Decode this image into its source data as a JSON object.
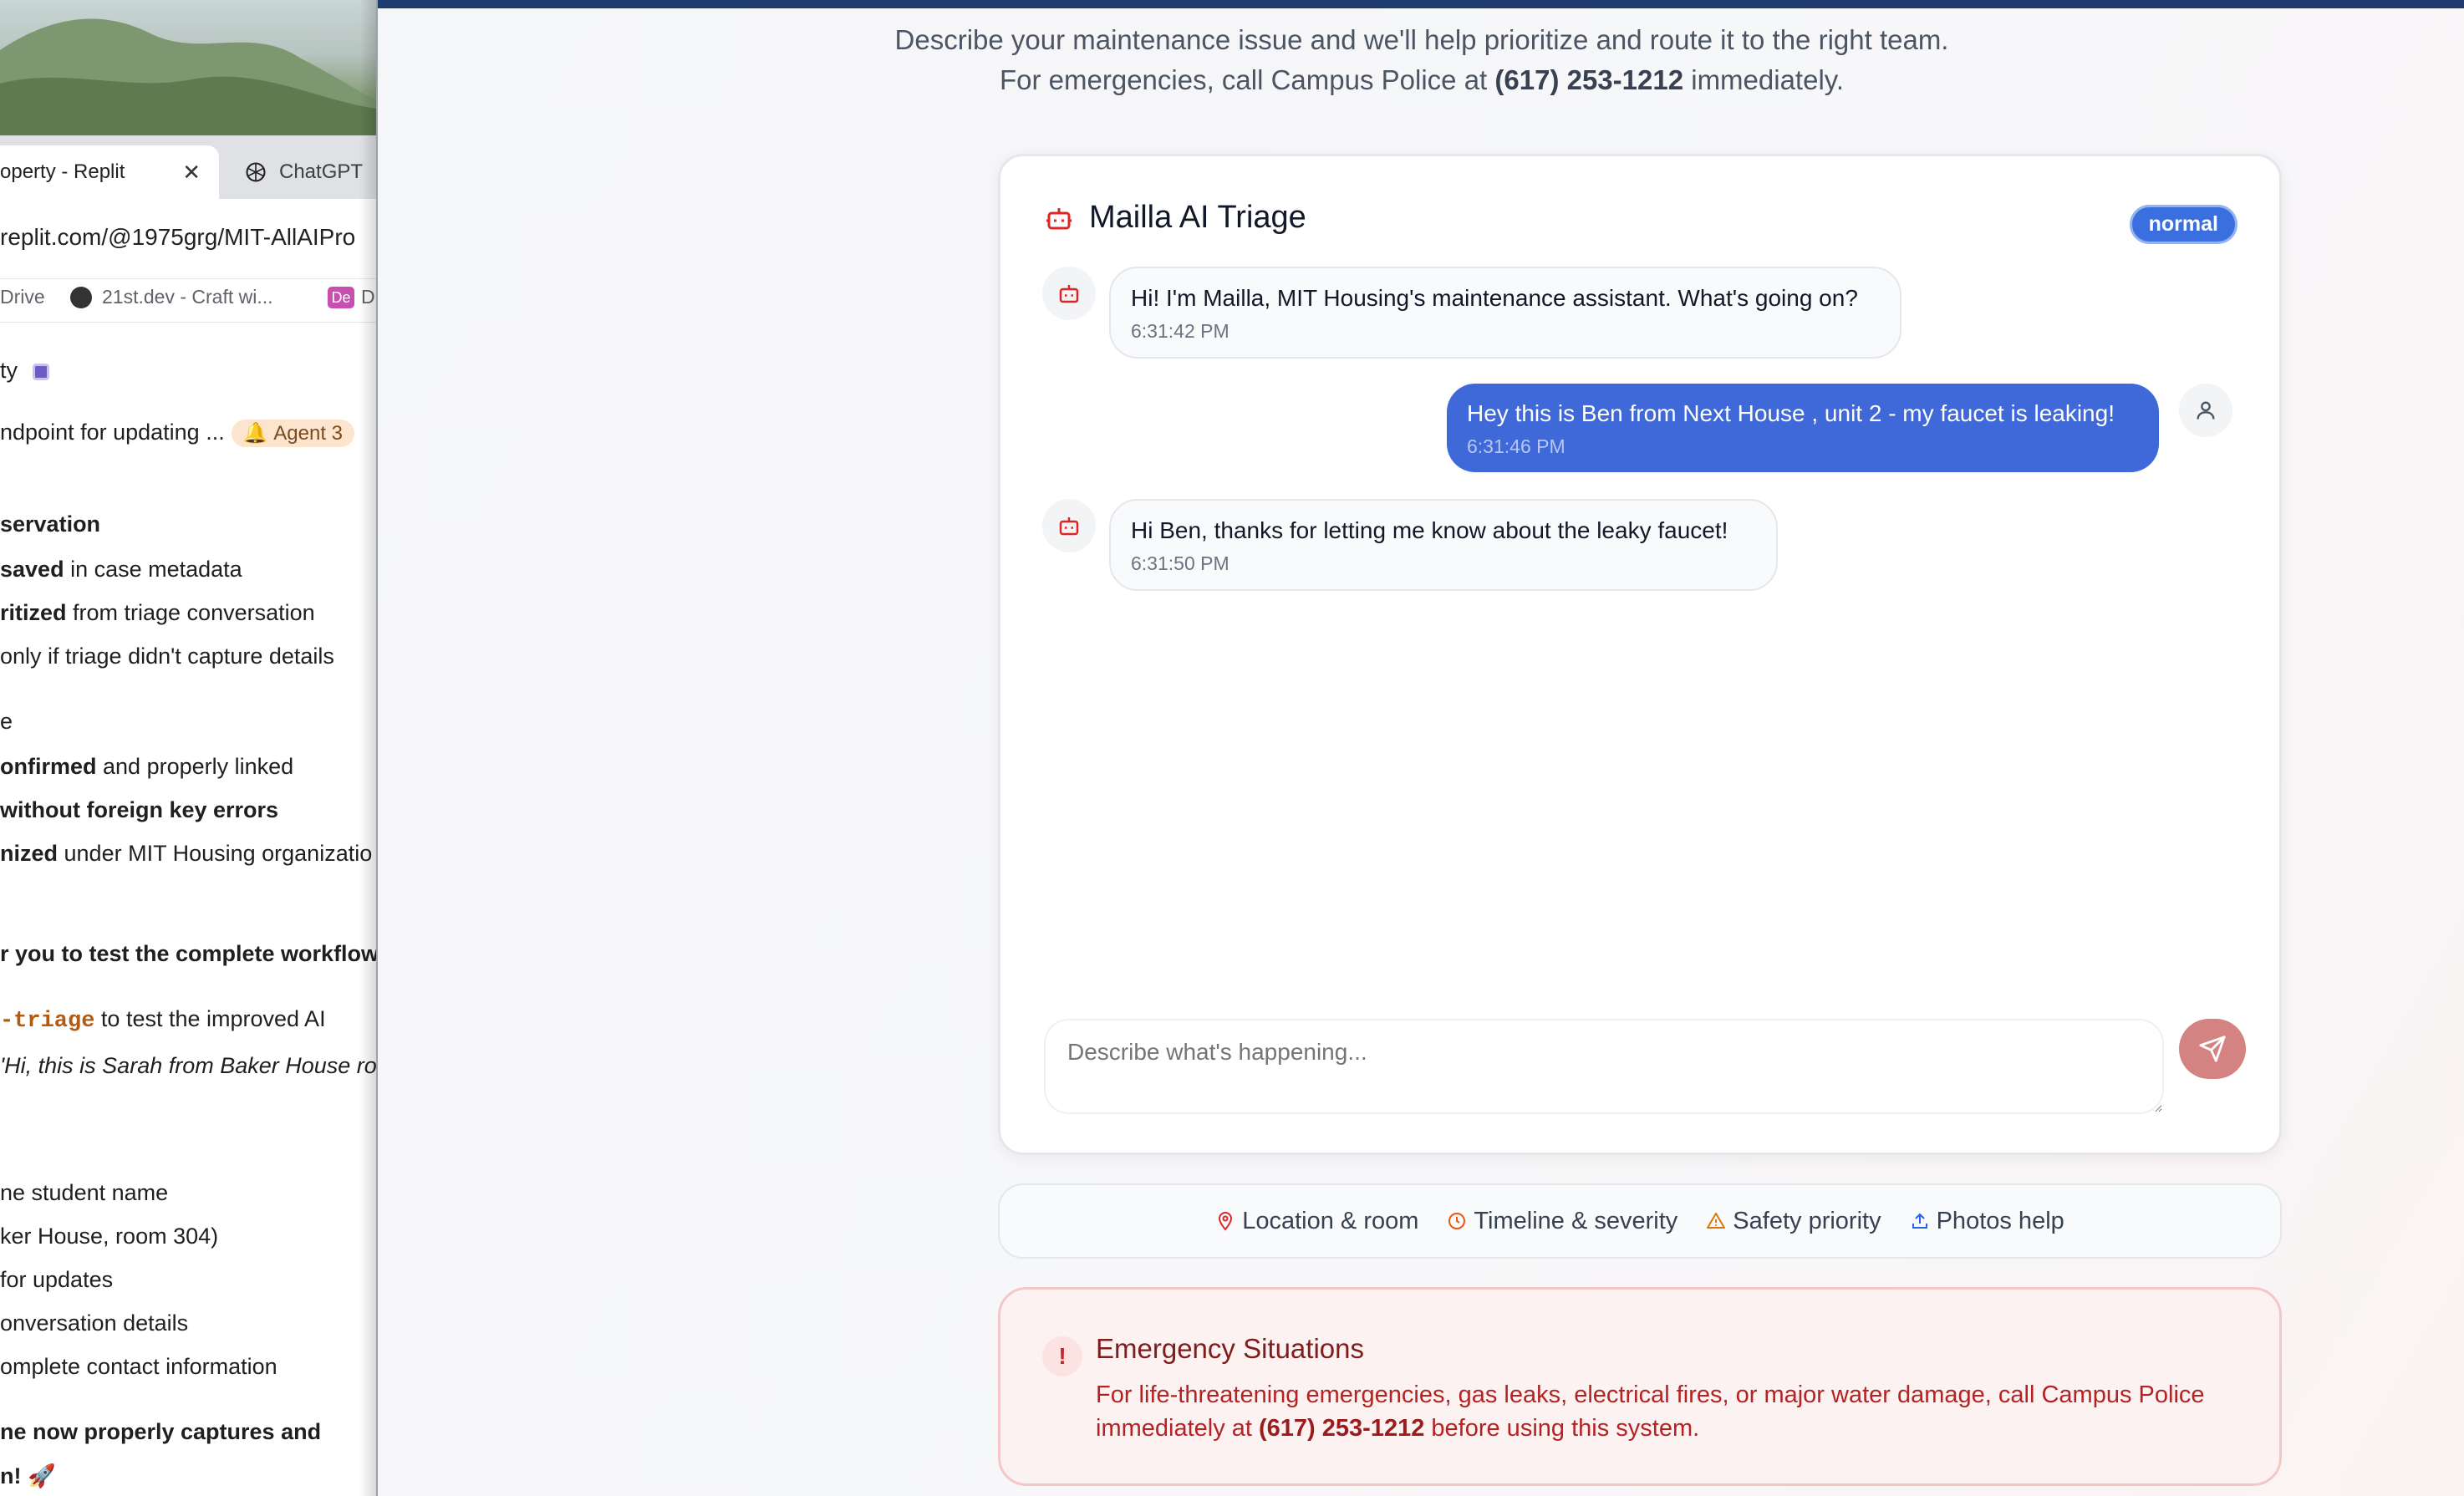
{
  "left_window": {
    "tabs": [
      {
        "label": "roperty - Replit",
        "close": "✕"
      },
      {
        "label": "ChatGPT"
      }
    ],
    "url": "replit.com/@1975grg/MIT-AllAIPro",
    "bookmarks": [
      {
        "label": "Drive"
      },
      {
        "label": "21st.dev - Craft wi..."
      },
      {
        "label": "D",
        "badge": "De"
      }
    ],
    "agent_lines": {
      "l1": "ty",
      "l2": "ndpoint for updating ...",
      "agent_badge": "Agent 3",
      "l3_bold": "servation",
      "l4_bold": "saved",
      "l4_rest": " in case metadata",
      "l5_bold": "ritized",
      "l5_rest": " from triage conversation",
      "l6": " only if triage didn't capture details",
      "l7": "e",
      "l8_bold": "onfirmed",
      "l8_rest": " and properly linked",
      "l9_bold": " without foreign key errors",
      "l10_bold": "nized",
      "l10_rest": " under MIT Housing organizatio",
      "l11_bold": "r you to test the complete workflow",
      "l12_code": "-triage",
      "l12_rest": "  to test the improved AI",
      "l13": "'Hi, this is Sarah from Baker House ro",
      "l14": "ne student name",
      "l15": "ker House, room 304)",
      "l16": " for updates",
      "l17": "onversation details",
      "l18": "omplete contact information",
      "l19_bold": "ne now properly captures and",
      "l20_bold": "n! 🚀"
    }
  },
  "intro": {
    "line1": "Describe your maintenance issue and we'll help prioritize and route it to the right team.",
    "line2_pre": "For emergencies, call Campus Police at ",
    "line2_phone": "(617) 253-1212",
    "line2_post": " immediately."
  },
  "chat": {
    "title": "Mailla AI Triage",
    "status": "normal",
    "messages": [
      {
        "role": "bot",
        "text": "Hi! I'm Mailla, MIT Housing's maintenance assistant. What's going on?",
        "time": "6:31:42 PM"
      },
      {
        "role": "user",
        "text": "Hey this is Ben from Next House , unit 2 - my faucet is leaking!",
        "time": "6:31:46 PM"
      },
      {
        "role": "bot",
        "text": "Hi Ben, thanks for letting me know about the leaky faucet!",
        "time": "6:31:50 PM"
      }
    ],
    "input_placeholder": "Describe what's happening..."
  },
  "help_chips": [
    {
      "label": "Location & room",
      "icon": "map-pin-icon",
      "color": "#dc2626"
    },
    {
      "label": "Timeline & severity",
      "icon": "clock-icon",
      "color": "#ea580c"
    },
    {
      "label": "Safety priority",
      "icon": "warning-triangle-icon",
      "color": "#d97706"
    },
    {
      "label": "Photos help",
      "icon": "upload-icon",
      "color": "#2563eb"
    }
  ],
  "emergency": {
    "icon": "!",
    "title": "Emergency Situations",
    "body_pre": "For life-threatening emergencies, gas leaks, electrical fires, or major water damage, call Campus Police immediately at ",
    "phone": "(617) 253-1212",
    "body_post": " before using this system."
  },
  "colors": {
    "accent_blue": "#3f68d9",
    "top_bar": "#1e3a6e",
    "emergency_red": "#b42323",
    "send_button": "#d48282"
  }
}
